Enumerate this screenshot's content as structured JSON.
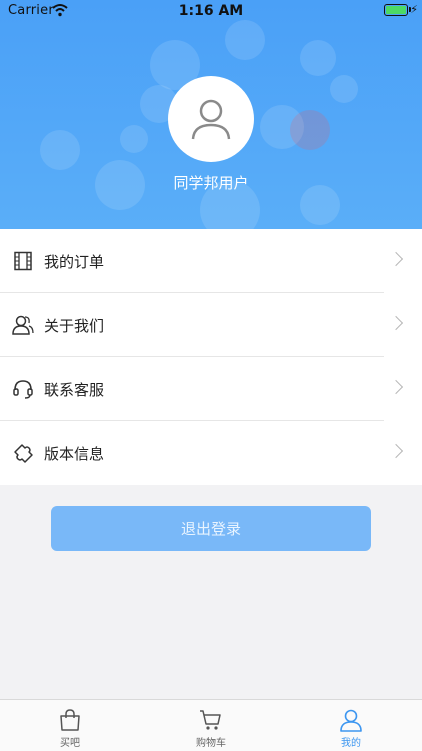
{
  "status_bar": {
    "carrier": "Carrier",
    "time": "1:16 AM",
    "battery_percent": 100
  },
  "profile": {
    "username": "同学邦用户"
  },
  "menu": [
    {
      "label": "我的订单",
      "icon": "film-icon"
    },
    {
      "label": "关于我们",
      "icon": "users-icon"
    },
    {
      "label": "联系客服",
      "icon": "headset-icon"
    },
    {
      "label": "版本信息",
      "icon": "puzzle-icon"
    }
  ],
  "logout_label": "退出登录",
  "tabs": [
    {
      "label": "买吧",
      "icon": "shopping-bag-icon",
      "active": false
    },
    {
      "label": "购物车",
      "icon": "cart-icon",
      "active": false
    },
    {
      "label": "我的",
      "icon": "user-icon",
      "active": true
    }
  ],
  "colors": {
    "header": "#4aa0f7",
    "accent": "#3c96f0",
    "logout_button": "#79b8f8"
  }
}
